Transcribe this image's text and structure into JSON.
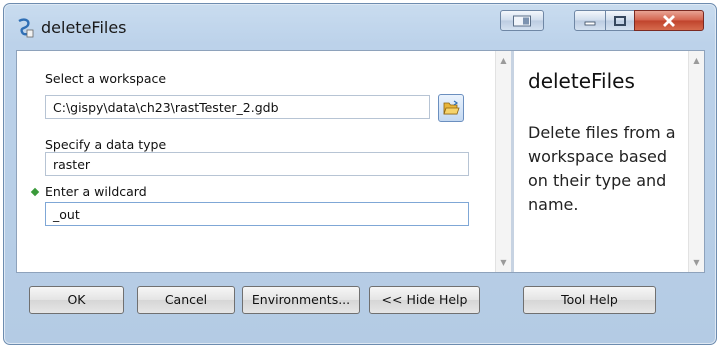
{
  "window": {
    "title": "deleteFiles",
    "help_title": "deleteFiles",
    "help_text": "Delete files from a workspace based on their type and name."
  },
  "params": {
    "workspace_label": "Select a workspace",
    "workspace_value": "C:\\gispy\\data\\ch23\\rastTester_2.gdb",
    "datatype_label": "Specify a data type",
    "datatype_value": "raster",
    "wildcard_label": "Enter a wildcard",
    "wildcard_value": "_out"
  },
  "buttons": {
    "ok": "OK",
    "cancel": "Cancel",
    "environments": "Environments...",
    "hide_help": "<< Hide Help",
    "tool_help": "Tool Help"
  },
  "icons": {
    "app": "toolbox-script-icon",
    "browse": "open-folder-icon",
    "required": "green-diamond-icon"
  },
  "colors": {
    "titlebar": "#bcd2ea",
    "close_button": "#c0432c",
    "required_marker": "#3a9a3a"
  }
}
